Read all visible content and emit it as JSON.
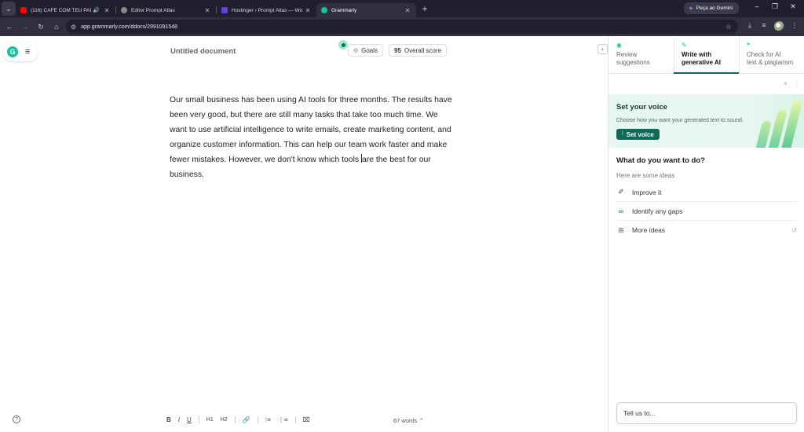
{
  "browser": {
    "tabs": [
      {
        "title": "(116) CAFÉ COM TEU PAI :",
        "favicon_color": "#ff0000",
        "audio": true
      },
      {
        "title": "Editor Prompt Atlas",
        "favicon_color": "#8a8a8a",
        "audio": false
      },
      {
        "title": "Hostinger › Prompt Atlas — Wo",
        "favicon_color": "#673de6",
        "audio": false
      },
      {
        "title": "Grammarly",
        "favicon_color": "#15c39a",
        "audio": false,
        "active": true
      }
    ],
    "new_tab": "+",
    "gemini_label": "Peça ao Gemini",
    "url": "app.grammarly.com/ddocs/2991091548"
  },
  "editor": {
    "logo": "G",
    "doc_title": "Untitled document",
    "goals_label": "Goals",
    "score_value": "95",
    "score_label": "Overall score",
    "body_before_caret": "Our small business has been using AI tools for three months. The results have been very good, but there are still many tasks that take too much time. We want to use artificial intelligence to write emails, create marketing content, and organize customer information. This can help our team work faster and make fewer mistakes. However, we don't know which tools ",
    "body_after_caret": "are the best for our business.",
    "word_count": "67 words",
    "format": {
      "bold": "B",
      "italic": "I",
      "underline": "U",
      "h1": "H1",
      "h2": "H2"
    }
  },
  "panel": {
    "tabs": [
      {
        "line1": "Review",
        "line2": "suggestions"
      },
      {
        "line1": "Write with",
        "line2": "generative AI",
        "active": true
      },
      {
        "line1": "Check for AI",
        "line2": "text & plagiarism"
      }
    ],
    "voice": {
      "title": "Set your voice",
      "description": "Choose how you want your generated text to sound.",
      "button": "Set voice"
    },
    "what_title": "What do you want to do?",
    "ideas_label": "Here are some ideas",
    "options": [
      "Improve it",
      "Identify any gaps",
      "More ideas"
    ],
    "prompt_placeholder": "Tell us to..."
  },
  "colors": {
    "brand": "#15c39a",
    "accent_dark": "#0e6b55"
  }
}
